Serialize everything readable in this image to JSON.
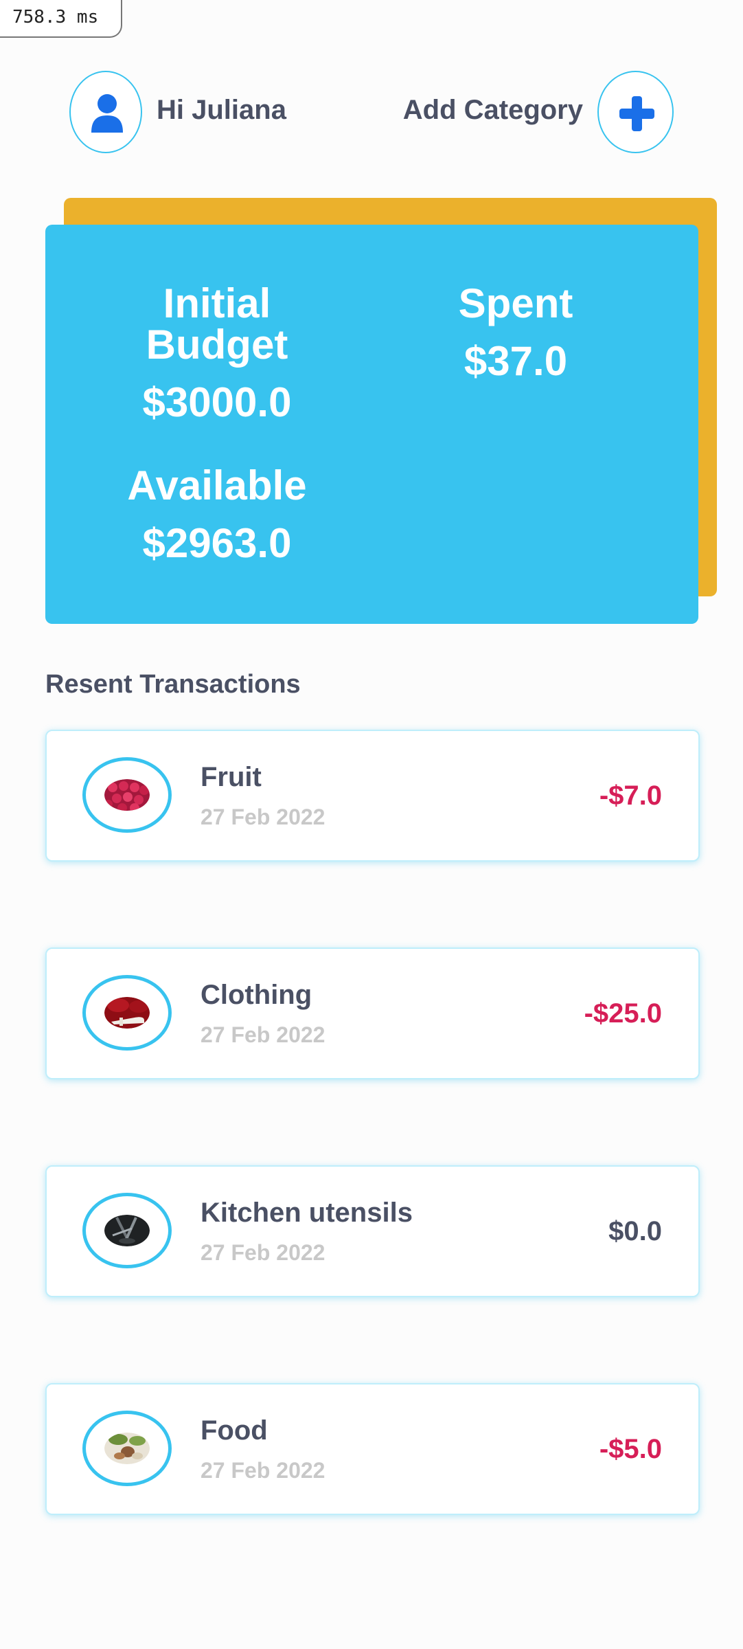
{
  "perf": {
    "timing": "758.3 ms"
  },
  "header": {
    "greeting": "Hi Juliana",
    "add_category_label": "Add Category",
    "avatar_icon": "user-icon",
    "add_icon": "plus-icon"
  },
  "budget": {
    "initial_label": "Initial Budget",
    "initial_value": "$3000.0",
    "spent_label": "Spent",
    "spent_value": "$37.0",
    "available_label": "Available",
    "available_value": "$2963.0"
  },
  "section": {
    "title": "Resent Transactions"
  },
  "transactions": [
    {
      "name": "Fruit",
      "date": "27 Feb 2022",
      "amount": "-$7.0",
      "image": "fruit-image"
    },
    {
      "name": "Clothing",
      "date": "27 Feb 2022",
      "amount": "-$25.0",
      "image": "clothing-image"
    },
    {
      "name": "Kitchen utensils",
      "date": "27 Feb 2022",
      "amount": "$0.0",
      "image": "kitchen-utensils-image"
    },
    {
      "name": "Food",
      "date": "27 Feb 2022",
      "amount": "-$5.0",
      "image": "food-image"
    }
  ],
  "colors": {
    "accent": "#38c3ef",
    "card_shadow": "#ebb12c",
    "negative": "#d61e57",
    "text": "#4a5064",
    "muted": "#c8c8c8",
    "icon_blue": "#1a6fe8"
  }
}
